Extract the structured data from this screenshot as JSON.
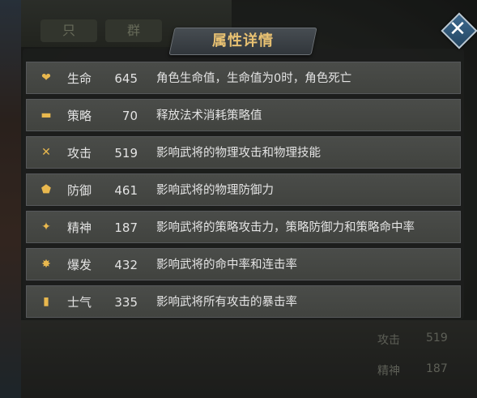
{
  "panel": {
    "title": "属性详情"
  },
  "background": {
    "tabs": [
      "只",
      "群"
    ],
    "bottom_stats": [
      {
        "name": "攻击",
        "value": "519"
      },
      {
        "name": "精神",
        "value": "187"
      }
    ]
  },
  "attributes": [
    {
      "icon": "heart-icon",
      "name": "生命",
      "value": "645",
      "desc": "角色生命值，生命值为0时，角色死亡"
    },
    {
      "icon": "book-icon",
      "name": "策略",
      "value": "70",
      "desc": "释放法术消耗策略值"
    },
    {
      "icon": "crossed-swords-icon",
      "name": "攻击",
      "value": "519",
      "desc": "影响武将的物理攻击和物理技能"
    },
    {
      "icon": "shield-icon",
      "name": "防御",
      "value": "461",
      "desc": "影响武将的物理防御力"
    },
    {
      "icon": "spirit-icon",
      "name": "精神",
      "value": "187",
      "desc": "影响武将的策略攻击力，策略防御力和策略命中率"
    },
    {
      "icon": "burst-icon",
      "name": "爆发",
      "value": "432",
      "desc": "影响武将的命中率和连击率"
    },
    {
      "icon": "banner-icon",
      "name": "士气",
      "value": "335",
      "desc": "影响武将所有攻击的暴击率"
    }
  ]
}
